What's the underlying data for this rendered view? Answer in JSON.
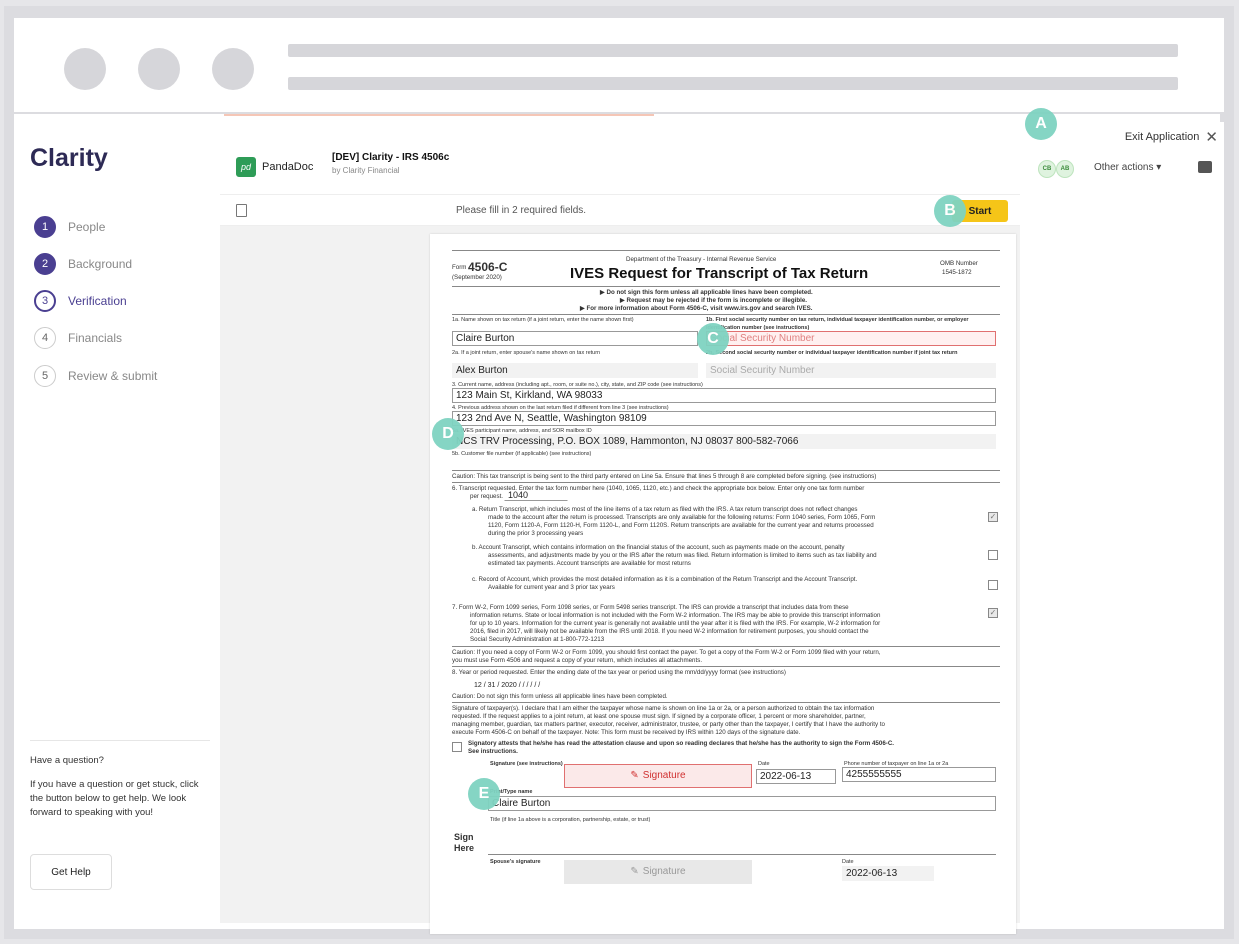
{
  "sidebar": {
    "logo": "Clarity",
    "steps": [
      {
        "num": "1",
        "label": "People"
      },
      {
        "num": "2",
        "label": "Background"
      },
      {
        "num": "3",
        "label": "Verification"
      },
      {
        "num": "4",
        "label": "Financials"
      },
      {
        "num": "5",
        "label": "Review & submit"
      }
    ],
    "help_title": "Have a question?",
    "help_text": "If you have a question or get stuck, click the button below to get help. We look forward to speaking with you!",
    "help_button": "Get Help"
  },
  "header": {
    "exit_label": "Exit Application",
    "exit_icon": "close-icon",
    "brand_icon_text": "pd",
    "brand_name": "PandaDoc",
    "doc_title": "[DEV] Clarity - IRS 4506c",
    "doc_sub": "by Clarity Financial",
    "avatars": [
      "CB",
      "AB"
    ],
    "other_actions": "Other actions ▾"
  },
  "toolbar": {
    "message": "Please fill in 2 required fields.",
    "start_label": "Start"
  },
  "badges": [
    "A",
    "B",
    "C",
    "D",
    "E"
  ],
  "form": {
    "form_label": "Form",
    "form_number": "4506-C",
    "form_date": "(September 2020)",
    "dept": "Department of the Treasury - Internal Revenue Service",
    "title": "IVES Request for Transcript of Tax Return",
    "omb": "OMB Number",
    "omb_num": "1545-1872",
    "notice1": "▶ Do not sign this form unless all applicable lines have been completed.",
    "notice2": "▶ Request may be rejected if the form is incomplete or illegible.",
    "notice3": "▶ For more information about Form 4506-C, visit www.irs.gov and search IVES.",
    "l1a": "1a. Name shown on tax return (if a joint return, enter the name shown first)",
    "l1b": "1b. First social security number on tax return, individual taxpayer identification number, or employer identification number (see instructions)",
    "name1": "Claire Burton",
    "ssn1_placeholder": "Social Security Number",
    "l2a": "2a. If a joint return, enter spouse's name shown on tax return",
    "l2b": "2b. Second social security number or individual taxpayer identification number if joint tax return",
    "name2": "Alex Burton",
    "ssn2_placeholder": "Social Security Number",
    "l3": "3. Current name, address (including apt., room, or suite no.), city, state, and ZIP code (see instructions)",
    "addr1": "123 Main St, Kirkland, WA 98033",
    "l4": "4. Previous address shown on the last return filed if different from line 3 (see instructions)",
    "addr2": "123 2nd Ave N, Seattle, Washington 98109",
    "l5a": "5a. IVES participant name, address, and SOR mailbox ID",
    "ives": "NCS TRV Processing, P.O. BOX 1089, Hammonton, NJ 08037     800-582-7066",
    "l5b": "5b. Customer file number (if applicable) (see instructions)",
    "caution1": "Caution: This tax transcript is being sent to the third party entered on Line 5a. Ensure that lines 5 through 8 are completed before signing. (see instructions)",
    "l6": "6.   Transcript requested. Enter the tax form number here (1040, 1065, 1120, etc.) and check the appropriate box below. Enter only one tax form number",
    "l6b": "per request.",
    "tax_form": "1040",
    "a_text": "a.   Return Transcript, which includes most of the line items of a tax return as filed with the IRS. A tax return transcript does not reflect changes",
    "a_text2": "made to the account after the return is processed. Transcripts are only available for the following returns: Form 1040 series, Form 1065, Form",
    "a_text3": "1120, Form 1120-A, Form 1120-H, Form 1120-L, and Form 1120S. Return transcripts are available for the current year and returns processed",
    "a_text4": "during the prior 3 processing years",
    "b_text": "b.   Account Transcript, which contains information on the financial status of the account, such as payments made on the account, penalty",
    "b_text2": "assessments, and adjustments made by you or the IRS after the return was filed. Return information is limited to items such as tax liability and",
    "b_text3": "estimated tax payments. Account transcripts are available for most returns",
    "c_text": "c.   Record of Account, which provides the most detailed information as it is a combination of the Return Transcript and the Account Transcript.",
    "c_text2": "Available for current year and 3 prior tax years",
    "l7": "7.   Form W-2, Form 1099 series, Form 1098 series, or Form 5498 series transcript. The IRS can provide a transcript that includes data from these",
    "l7b": "information returns. State or local information is not included with the Form W-2 information. The IRS may be able to provide this transcript information",
    "l7c": "for up to 10 years. Information for the current year is generally not available until the year after it is filed with the IRS. For example, W-2 information for",
    "l7d": "2016, filed in 2017, will likely not be available from the IRS until 2018. If you need W-2 information for retirement purposes, you should contact the",
    "l7e": "Social Security Administration at 1-800-772-1213",
    "caution2": "Caution: If you need a copy of Form W-2 or Form 1099, you should first contact the payer. To get a copy of the Form W-2 or Form 1099 filed with your return,",
    "caution2b": "you must use Form 4506 and request a copy of your return, which includes all attachments.",
    "l8": "8.   Year or period requested. Enter the ending date of the tax year or period using the mm/dd/yyyy format (see instructions)",
    "year": "12  /  31  /  2020           /      /                    /      /                   /      /",
    "caution3": "Caution: Do not sign this form unless all applicable lines have been completed.",
    "sig_text1": "Signature of taxpayer(s). I declare that I am either the taxpayer whose name is shown on line 1a or 2a, or a person authorized to obtain the tax information",
    "sig_text2": "requested. If the request applies to a joint return, at least one spouse must sign. If signed by a corporate officer, 1 percent or more shareholder, partner,",
    "sig_text3": "managing member, guardian, tax matters partner, executor, receiver, administrator, trustee, or party other than the taxpayer, I certify that I have the authority to",
    "sig_text4": "execute Form 4506-C on behalf of the taxpayer. Note: This form must be received by IRS within 120 days of the signature date.",
    "attest": "Signatory attests that he/she has read the attestation clause and upon so reading declares that he/she has the authority to sign the Form 4506-C.",
    "attest2": "See instructions.",
    "sig_label": "Signature (see instructions)",
    "sig_btn": "Signature",
    "date_label": "Date",
    "date1": "2022-06-13",
    "phone_label": "Phone number of taxpayer on line 1a or 2a",
    "phone": "4255555555",
    "print_label": "Print/Type name",
    "print_name": "Claire Burton",
    "title_label": "Title (if line 1a above is a corporation, partnership, estate, or trust)",
    "sign": "Sign",
    "here": "Here",
    "spouse_label": "Spouse's signature",
    "sig2_btn": "Signature",
    "date2_label": "Date",
    "date2": "2022-06-13"
  }
}
